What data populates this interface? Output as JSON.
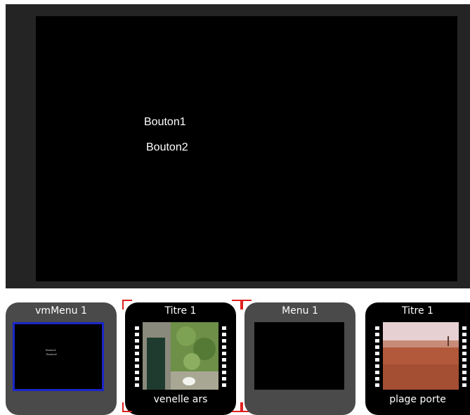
{
  "preview": {
    "buttons": [
      "Bouton1",
      "Bouton2"
    ]
  },
  "thumbnails": [
    {
      "kind": "menu",
      "label": "vmMenu 1",
      "selected": true,
      "mini_buttons": [
        "Bouton1",
        "Bouton2"
      ]
    },
    {
      "kind": "title",
      "label": "Titre 1",
      "caption": "venelle ars",
      "image": "garden-gate-photo",
      "highlighted": true
    },
    {
      "kind": "menu",
      "label": "Menu 1",
      "selected": false
    },
    {
      "kind": "title",
      "label": "Titre 1",
      "caption": "plage porte",
      "image": "beach-photo",
      "highlighted": false
    }
  ],
  "colors": {
    "selection_border": "#1a26c8",
    "highlight_marker": "#e02020"
  }
}
